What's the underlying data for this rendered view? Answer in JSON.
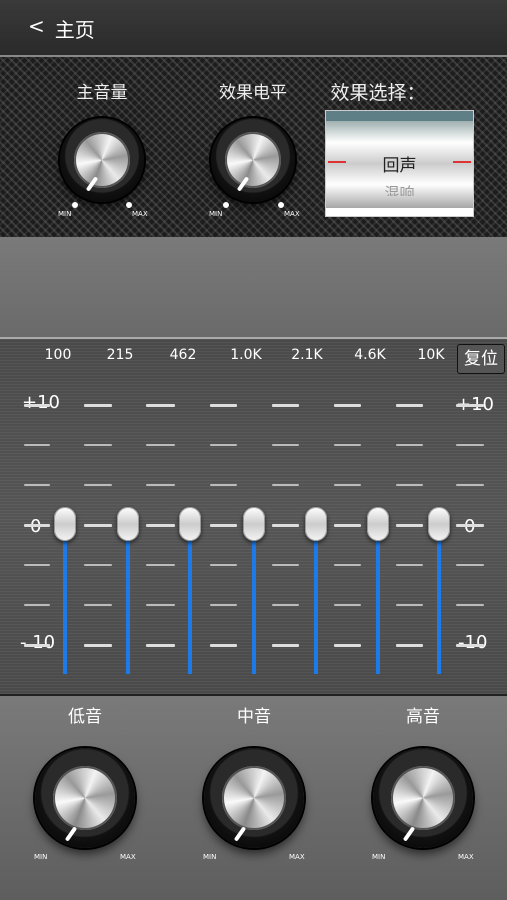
{
  "header": {
    "back_icon": "<",
    "title": "主页"
  },
  "top_panel": {
    "master_volume": {
      "label": "主音量",
      "min": "MIN",
      "max": "MAX"
    },
    "effect_level": {
      "label": "效果电平",
      "min": "MIN",
      "max": "MAX"
    },
    "effect_select": {
      "label": "效果选择：",
      "selected": "回声",
      "next": "混响"
    }
  },
  "eq": {
    "bands": [
      "100",
      "215",
      "462",
      "1.0K",
      "2.1K",
      "4.6K",
      "10K"
    ],
    "reset_label": "复位",
    "scale_left": {
      "top": "+10",
      "mid": "0",
      "bottom": "- 10"
    },
    "scale_right": {
      "top": "+10",
      "mid": "0",
      "bottom": "-10"
    },
    "levels_db": [
      0,
      0,
      0,
      0,
      0,
      0,
      0
    ]
  },
  "tone": {
    "bass": {
      "label": "低音",
      "min": "MIN",
      "max": "MAX"
    },
    "mid": {
      "label": "中音",
      "min": "MIN",
      "max": "MAX"
    },
    "treble": {
      "label": "高音",
      "min": "MIN",
      "max": "MAX"
    }
  },
  "colors": {
    "slider_track": "#1e7ae8",
    "picker_tick": "#dd3333"
  }
}
